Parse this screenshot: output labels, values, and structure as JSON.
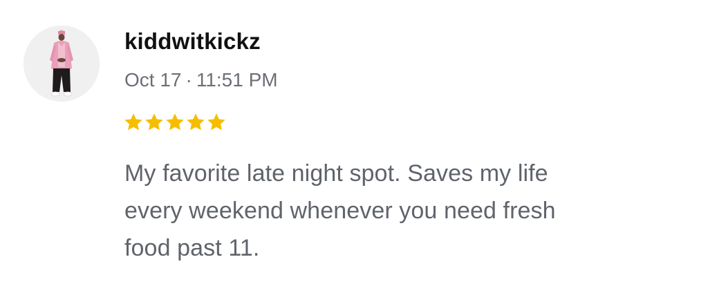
{
  "review": {
    "username": "kiddwitkickz",
    "date": "Oct 17",
    "separator": "·",
    "time": "11:51 PM",
    "rating": 5,
    "max_rating": 5,
    "star_icon": "star-icon",
    "star_color": "#F6BE00",
    "text": "My favorite late night spot. Saves my life every weekend whenever you need fresh food past 11.",
    "avatar_icon": "user-avatar-figure"
  }
}
